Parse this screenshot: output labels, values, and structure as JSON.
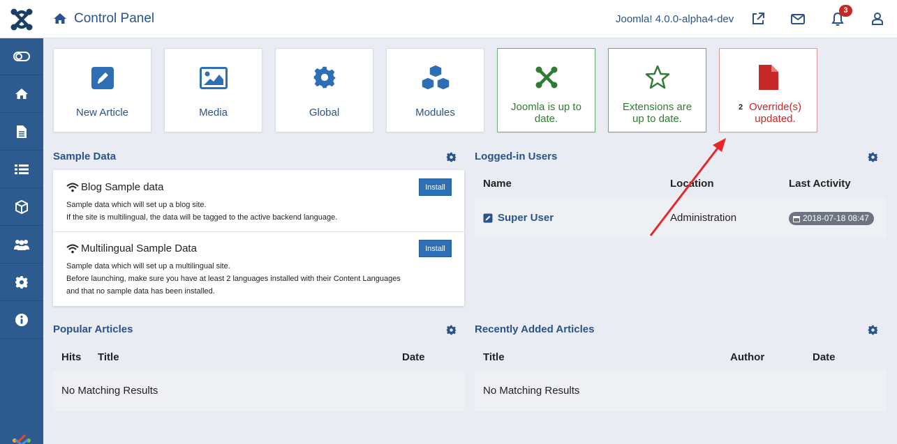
{
  "header": {
    "title": "Control Panel",
    "version": "Joomla! 4.0.0-alpha4-dev",
    "notifications_count": "3"
  },
  "tiles": [
    {
      "label": "New Article",
      "icon": "pencil-square-icon"
    },
    {
      "label": "Media",
      "icon": "image-icon"
    },
    {
      "label": "Global",
      "icon": "gear-icon"
    },
    {
      "label": "Modules",
      "icon": "cubes-icon"
    },
    {
      "label": "Joomla is up to date.",
      "icon": "joomla-icon"
    },
    {
      "label": "Extensions are up to date.",
      "icon": "star-icon"
    },
    {
      "label": "Override(s) updated.",
      "count": "2",
      "icon": "file-icon"
    }
  ],
  "sample_data": {
    "title": "Sample Data",
    "items": [
      {
        "name": "Blog Sample data",
        "desc1": "Sample data which will set up a blog site.",
        "desc2": "If the site is multilingual, the data will be tagged to the active backend language.",
        "button": "Install"
      },
      {
        "name": "Multilingual Sample Data",
        "desc1": "Sample data which will set up a multilingual site.",
        "desc2": "Before launching, make sure you have at least 2 languages installed with their Content Languages",
        "desc3": "and that no sample data has been installed.",
        "button": "Install"
      }
    ]
  },
  "logged_users": {
    "title": "Logged-in Users",
    "columns": [
      "Name",
      "Location",
      "Last Activity"
    ],
    "rows": [
      {
        "name": "Super User",
        "location": "Administration",
        "last_activity": "2018-07-18 08:47"
      }
    ]
  },
  "popular_articles": {
    "title": "Popular Articles",
    "columns": [
      "Hits",
      "Title",
      "Date"
    ],
    "empty": "No Matching Results"
  },
  "recent_articles": {
    "title": "Recently Added Articles",
    "columns": [
      "Title",
      "Author",
      "Date"
    ],
    "empty": "No Matching Results"
  },
  "colors": {
    "primary": "#2a5389",
    "sidebar": "#2d5b90",
    "success": "#2f7d32",
    "danger": "#c52827",
    "annotation_arrow": "#e8262b"
  }
}
